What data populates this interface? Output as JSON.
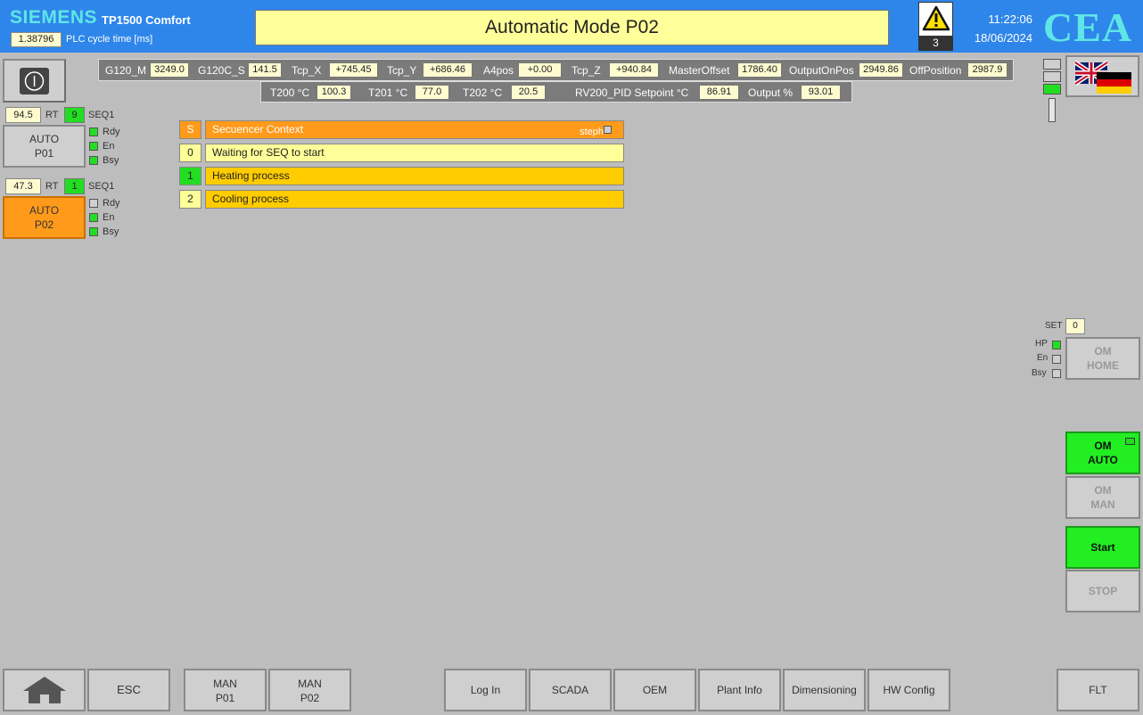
{
  "header": {
    "brand": "SIEMENS",
    "model": "TP1500 Comfort",
    "cycle_time": "1.38796",
    "cycle_label": "PLC cycle time [ms]",
    "title": "Automatic Mode P02",
    "alarm_count": "3",
    "time": "11:22:06",
    "date": "18/06/2024",
    "logo": "CEA"
  },
  "measurements": {
    "row1": [
      {
        "label": "G120_M",
        "value": "3249.0"
      },
      {
        "label": "G120C_S",
        "value": "141.5"
      },
      {
        "label": "Tcp_X",
        "value": "+745.45"
      },
      {
        "label": "Tcp_Y",
        "value": "+686.46"
      },
      {
        "label": "A4pos",
        "value": "+0.00"
      },
      {
        "label": "Tcp_Z",
        "value": "+940.84"
      },
      {
        "label": "MasterOffset",
        "value": "1786.40"
      },
      {
        "label": "OutputOnPos",
        "value": "2949.86"
      },
      {
        "label": "OffPosition",
        "value": "2987.9"
      }
    ],
    "row2": [
      {
        "label": "T200 °C",
        "value": "100.3"
      },
      {
        "label": "T201 °C",
        "value": "77.0"
      },
      {
        "label": "T202 °C",
        "value": "20.5"
      },
      {
        "label": "RV200_PID Setpoint °C",
        "value": "86.91"
      },
      {
        "label": "Output %",
        "value": "93.01"
      }
    ]
  },
  "programs": [
    {
      "value": "94.5",
      "rt": "RT",
      "seq_value": "9",
      "seq": "SEQ1",
      "line1": "AUTO",
      "line2": "P01",
      "leds": [
        "Rdy",
        "En",
        "Bsy"
      ]
    },
    {
      "value": "47.3",
      "rt": "RT",
      "seq_value": "1",
      "seq": "SEQ1",
      "line1": "AUTO",
      "line2": "P02",
      "leds": [
        "Rdy",
        "En",
        "Bsy"
      ]
    }
  ],
  "sequencer": {
    "header_num": "S",
    "header_label": "Secuencer Context",
    "steph": "steph",
    "steps": [
      {
        "num": "0",
        "label": "Waiting for SEQ to start"
      },
      {
        "num": "1",
        "label": "Heating process"
      },
      {
        "num": "2",
        "label": "Cooling process"
      }
    ]
  },
  "right": {
    "set_label": "SET",
    "set_value": "0",
    "home_leds": [
      "HP",
      "En",
      "Bsy"
    ],
    "om_home": [
      "OM",
      "HOME"
    ],
    "om_auto": [
      "OM",
      "AUTO"
    ],
    "om_man": [
      "OM",
      "MAN"
    ],
    "start": "Start",
    "stop": "STOP"
  },
  "footer": {
    "esc": "ESC",
    "man_p01": [
      "MAN",
      "P01"
    ],
    "man_p02": [
      "MAN",
      "P02"
    ],
    "log_in": "Log In",
    "scada": "SCADA",
    "oem": "OEM",
    "plant_info": "Plant Info",
    "dimensioning": "Dimensioning",
    "hw_config": "HW Config",
    "flt": "FLT"
  },
  "colors": {
    "header_bg": "#2f86ea",
    "accent_cyan": "#5ee6e6",
    "active_green": "#22ee22",
    "active_orange": "#ff9a1a",
    "panel_bg": "#bdbdbd"
  }
}
